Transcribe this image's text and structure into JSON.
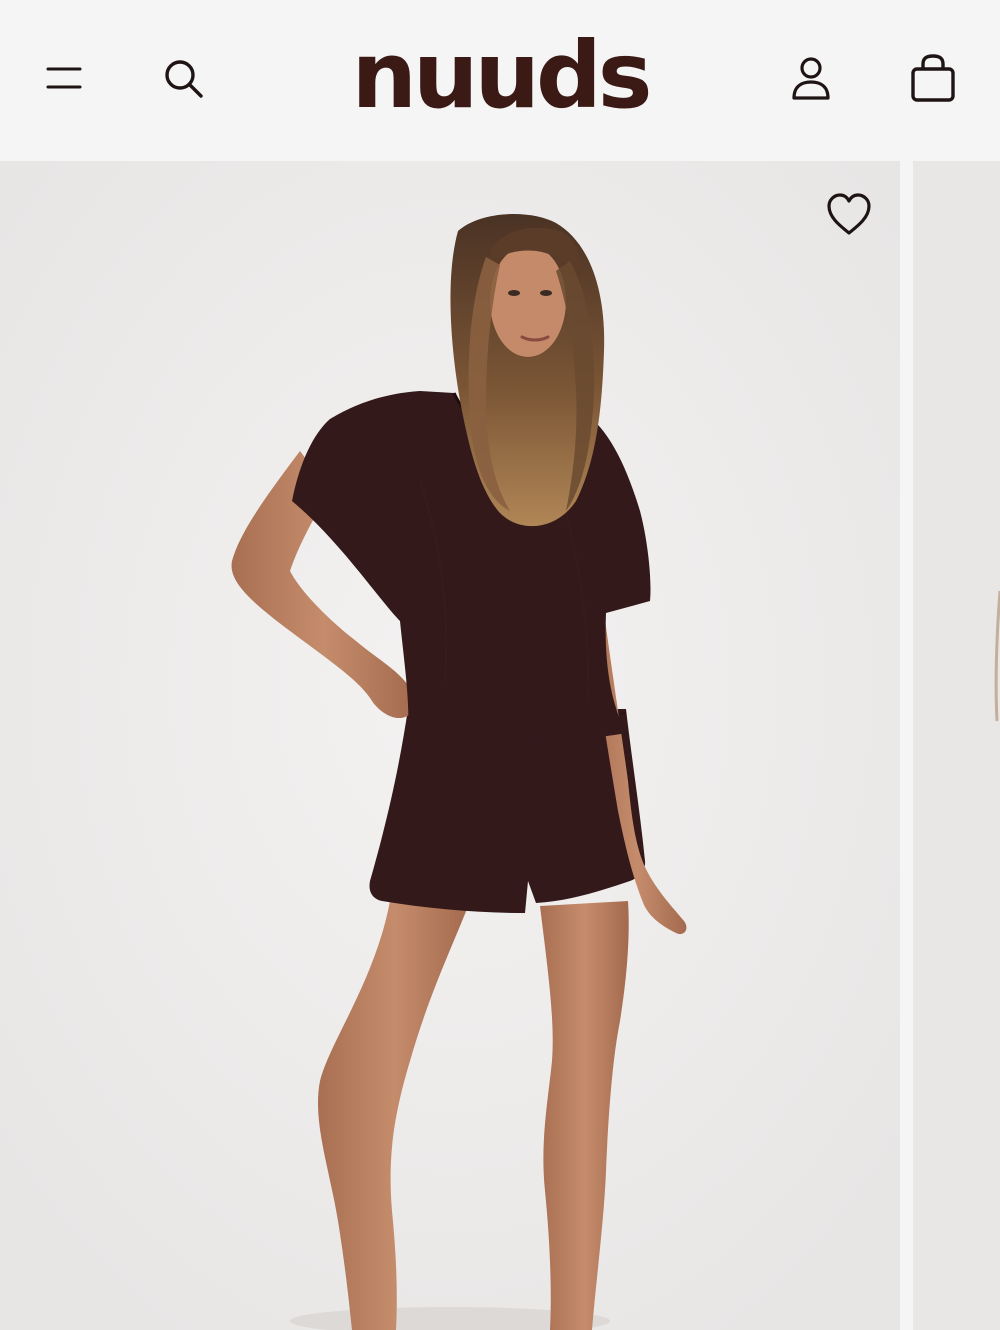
{
  "header": {
    "logo_text": "nuuds",
    "icons": {
      "menu": "menu-icon",
      "search": "search-icon",
      "account": "user-icon",
      "cart": "shopping-bag-icon"
    }
  },
  "product_gallery": {
    "main_image": "model-wearing-brown-v-neck-tee-and-shorts",
    "next_image": "product-image-partial",
    "wishlist_icon": "heart-icon"
  },
  "colors": {
    "brand": "#3b1a15",
    "header_bg": "#f6f5f5",
    "garment": "#33191a",
    "icon": "#1e1414"
  }
}
